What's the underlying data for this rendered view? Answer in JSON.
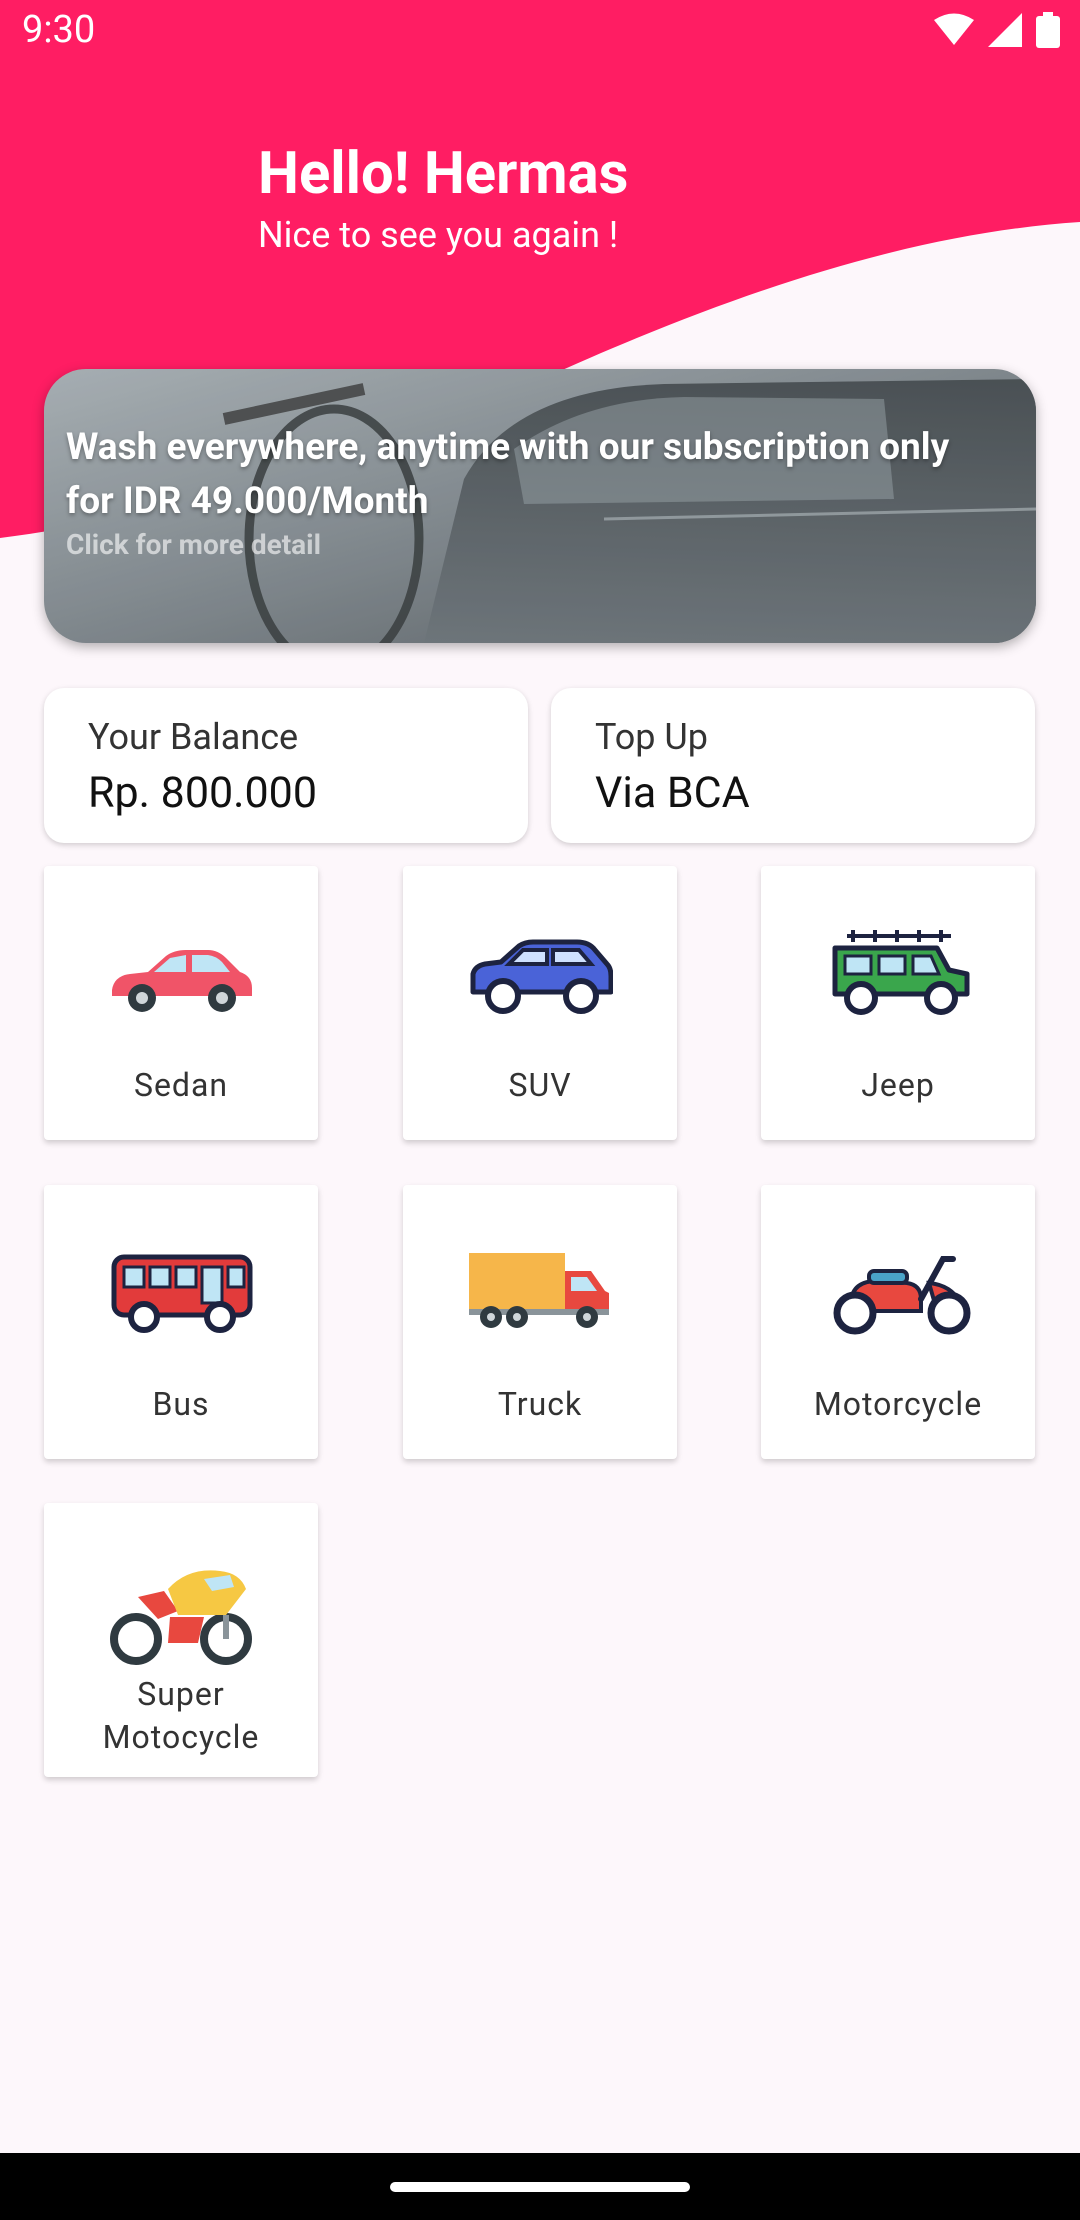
{
  "status_bar": {
    "time": "9:30"
  },
  "header": {
    "title": "Hello! Hermas",
    "subtitle": "Nice to see you again !"
  },
  "banner": {
    "headline": "Wash everywhere, anytime with our subscription only for IDR 49.000/Month",
    "subtext": "Click for more detail"
  },
  "balance": {
    "label": "Your Balance",
    "value": "Rp. 800.000"
  },
  "topup": {
    "label": "Top Up",
    "value": "Via BCA"
  },
  "vehicles": [
    {
      "label": "Sedan",
      "icon": "sedan-icon"
    },
    {
      "label": "SUV",
      "icon": "suv-icon"
    },
    {
      "label": "Jeep",
      "icon": "jeep-icon"
    },
    {
      "label": "Bus",
      "icon": "bus-icon"
    },
    {
      "label": "Truck",
      "icon": "truck-icon"
    },
    {
      "label": "Motorcycle",
      "icon": "motorcycle-icon"
    },
    {
      "label": "Super Motocycle",
      "icon": "super-motorcycle-icon"
    }
  ],
  "colors": {
    "accent": "#ff1d63",
    "background": "#fdf7fb"
  }
}
